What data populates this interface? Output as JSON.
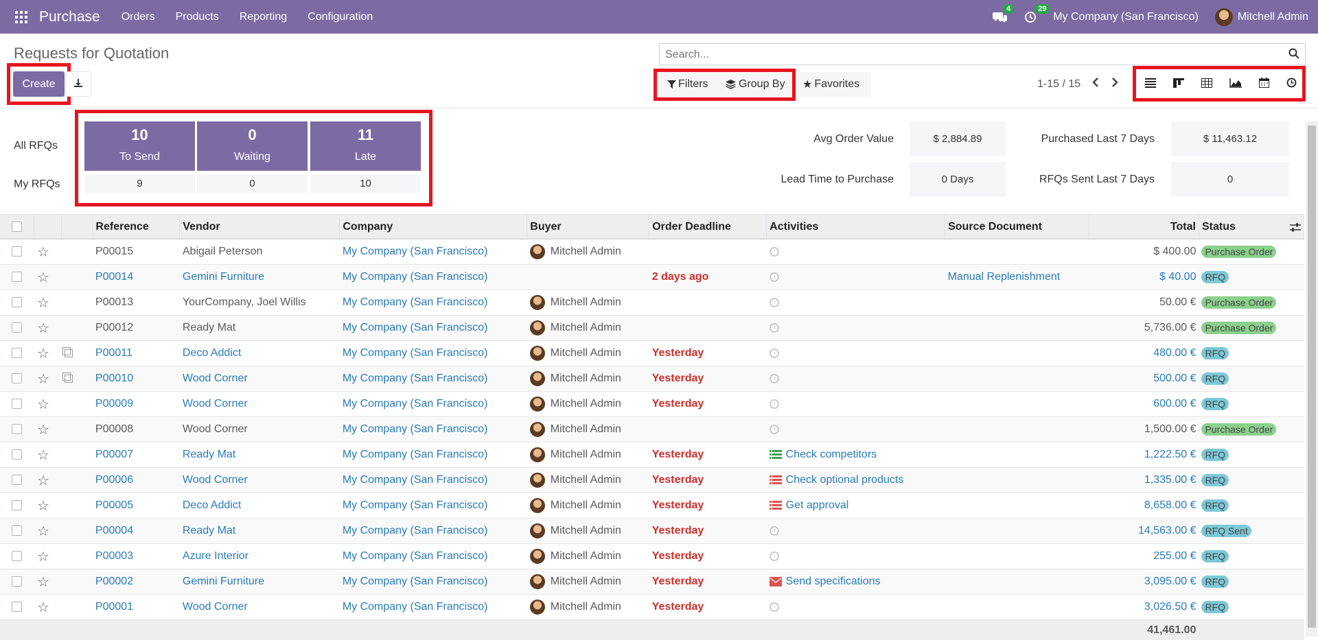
{
  "navbar": {
    "app_name": "Purchase",
    "menu": [
      "Orders",
      "Products",
      "Reporting",
      "Configuration"
    ],
    "messages_count": "4",
    "activities_count": "29",
    "company": "My Company (San Francisco)",
    "user": "Mitchell Admin"
  },
  "control_panel": {
    "title": "Requests for Quotation",
    "create_label": "Create",
    "search_placeholder": "Search...",
    "filters_label": "Filters",
    "group_by_label": "Group By",
    "favorites_label": "Favorites",
    "pager": "1-15 / 15"
  },
  "dashboard": {
    "all_rfqs_label": "All RFQs",
    "my_rfqs_label": "My RFQs",
    "tiles": [
      {
        "count": "10",
        "label": "To Send",
        "mine": "9"
      },
      {
        "count": "0",
        "label": "Waiting",
        "mine": "0"
      },
      {
        "count": "11",
        "label": "Late",
        "mine": "10"
      }
    ],
    "stats": [
      {
        "label": "Avg Order Value",
        "value": "$ 2,884.89"
      },
      {
        "label": "Purchased Last 7 Days",
        "value": "$ 11,463.12"
      },
      {
        "label": "Lead Time to Purchase",
        "value": "0 Days"
      },
      {
        "label": "RFQs Sent Last 7 Days",
        "value": "0"
      }
    ]
  },
  "table": {
    "columns": [
      "Reference",
      "Vendor",
      "Company",
      "Buyer",
      "Order Deadline",
      "Activities",
      "Source Document",
      "Total",
      "Status"
    ],
    "rows": [
      {
        "ref": "P00015",
        "vendor": "Abigail Peterson",
        "company": "My Company (San Francisco)",
        "buyer": "Mitchell Admin",
        "deadline": "",
        "activity": "",
        "activity_icon": "clock",
        "source": "",
        "total": "$ 400.00",
        "status": "Purchase Order",
        "status_kind": "po",
        "fresh": false,
        "copy": false,
        "late": false
      },
      {
        "ref": "P00014",
        "vendor": "Gemini Furniture",
        "company": "My Company (San Francisco)",
        "buyer": "",
        "deadline": "2 days ago",
        "activity": "",
        "activity_icon": "clock",
        "source": "Manual Replenishment",
        "total": "$ 40.00",
        "status": "RFQ",
        "status_kind": "rfq",
        "fresh": true,
        "copy": false,
        "late": true
      },
      {
        "ref": "P00013",
        "vendor": "YourCompany, Joel Willis",
        "company": "My Company (San Francisco)",
        "buyer": "Mitchell Admin",
        "deadline": "",
        "activity": "",
        "activity_icon": "clock",
        "source": "",
        "total": "50.00 €",
        "status": "Purchase Order",
        "status_kind": "po",
        "fresh": false,
        "copy": false,
        "late": false
      },
      {
        "ref": "P00012",
        "vendor": "Ready Mat",
        "company": "My Company (San Francisco)",
        "buyer": "Mitchell Admin",
        "deadline": "",
        "activity": "",
        "activity_icon": "clock",
        "source": "",
        "total": "5,736.00 €",
        "status": "Purchase Order",
        "status_kind": "po",
        "fresh": false,
        "copy": false,
        "late": false
      },
      {
        "ref": "P00011",
        "vendor": "Deco Addict",
        "company": "My Company (San Francisco)",
        "buyer": "Mitchell Admin",
        "deadline": "Yesterday",
        "activity": "",
        "activity_icon": "clock",
        "source": "",
        "total": "480.00 €",
        "status": "RFQ",
        "status_kind": "rfq",
        "fresh": true,
        "copy": true,
        "late": true
      },
      {
        "ref": "P00010",
        "vendor": "Wood Corner",
        "company": "My Company (San Francisco)",
        "buyer": "Mitchell Admin",
        "deadline": "Yesterday",
        "activity": "",
        "activity_icon": "clock",
        "source": "",
        "total": "500.00 €",
        "status": "RFQ",
        "status_kind": "rfq",
        "fresh": true,
        "copy": true,
        "late": true
      },
      {
        "ref": "P00009",
        "vendor": "Wood Corner",
        "company": "My Company (San Francisco)",
        "buyer": "Mitchell Admin",
        "deadline": "Yesterday",
        "activity": "",
        "activity_icon": "clock",
        "source": "",
        "total": "600.00 €",
        "status": "RFQ",
        "status_kind": "rfq",
        "fresh": true,
        "copy": false,
        "late": true
      },
      {
        "ref": "P00008",
        "vendor": "Wood Corner",
        "company": "My Company (San Francisco)",
        "buyer": "Mitchell Admin",
        "deadline": "",
        "activity": "",
        "activity_icon": "clock",
        "source": "",
        "total": "1,500.00 €",
        "status": "Purchase Order",
        "status_kind": "po",
        "fresh": false,
        "copy": false,
        "late": false
      },
      {
        "ref": "P00007",
        "vendor": "Ready Mat",
        "company": "My Company (San Francisco)",
        "buyer": "Mitchell Admin",
        "deadline": "Yesterday",
        "activity": "Check competitors",
        "activity_icon": "list-green",
        "source": "",
        "total": "1,222.50 €",
        "status": "RFQ",
        "status_kind": "rfq",
        "fresh": true,
        "copy": false,
        "late": true
      },
      {
        "ref": "P00006",
        "vendor": "Wood Corner",
        "company": "My Company (San Francisco)",
        "buyer": "Mitchell Admin",
        "deadline": "Yesterday",
        "activity": "Check optional products",
        "activity_icon": "list-red",
        "source": "",
        "total": "1,335.00 €",
        "status": "RFQ",
        "status_kind": "rfq",
        "fresh": true,
        "copy": false,
        "late": true
      },
      {
        "ref": "P00005",
        "vendor": "Deco Addict",
        "company": "My Company (San Francisco)",
        "buyer": "Mitchell Admin",
        "deadline": "Yesterday",
        "activity": "Get approval",
        "activity_icon": "list-red",
        "source": "",
        "total": "8,658.00 €",
        "status": "RFQ",
        "status_kind": "rfq",
        "fresh": true,
        "copy": false,
        "late": true
      },
      {
        "ref": "P00004",
        "vendor": "Ready Mat",
        "company": "My Company (San Francisco)",
        "buyer": "Mitchell Admin",
        "deadline": "Yesterday",
        "activity": "",
        "activity_icon": "clock",
        "source": "",
        "total": "14,563.00 €",
        "status": "RFQ Sent",
        "status_kind": "rfq",
        "fresh": true,
        "copy": false,
        "late": true
      },
      {
        "ref": "P00003",
        "vendor": "Azure Interior",
        "company": "My Company (San Francisco)",
        "buyer": "Mitchell Admin",
        "deadline": "Yesterday",
        "activity": "",
        "activity_icon": "clock",
        "source": "",
        "total": "255.00 €",
        "status": "RFQ",
        "status_kind": "rfq",
        "fresh": true,
        "copy": false,
        "late": true
      },
      {
        "ref": "P00002",
        "vendor": "Gemini Furniture",
        "company": "My Company (San Francisco)",
        "buyer": "Mitchell Admin",
        "deadline": "Yesterday",
        "activity": "Send specifications",
        "activity_icon": "envelope-red",
        "source": "",
        "total": "3,095.00 €",
        "status": "RFQ",
        "status_kind": "rfq",
        "fresh": true,
        "copy": false,
        "late": true
      },
      {
        "ref": "P00001",
        "vendor": "Wood Corner",
        "company": "My Company (San Francisco)",
        "buyer": "Mitchell Admin",
        "deadline": "Yesterday",
        "activity": "",
        "activity_icon": "clock",
        "source": "",
        "total": "3,026.50 €",
        "status": "RFQ",
        "status_kind": "rfq",
        "fresh": true,
        "copy": false,
        "late": true
      }
    ],
    "grand_total": "41,461.00"
  },
  "colors": {
    "brand": "#7c6ba3",
    "highlight": "#e8141f",
    "link": "#2a7bb7",
    "late": "#c9302c",
    "po_badge": "#8bd08d",
    "rfq_badge": "#7dc8d6",
    "counter_badge": "#28a745"
  }
}
